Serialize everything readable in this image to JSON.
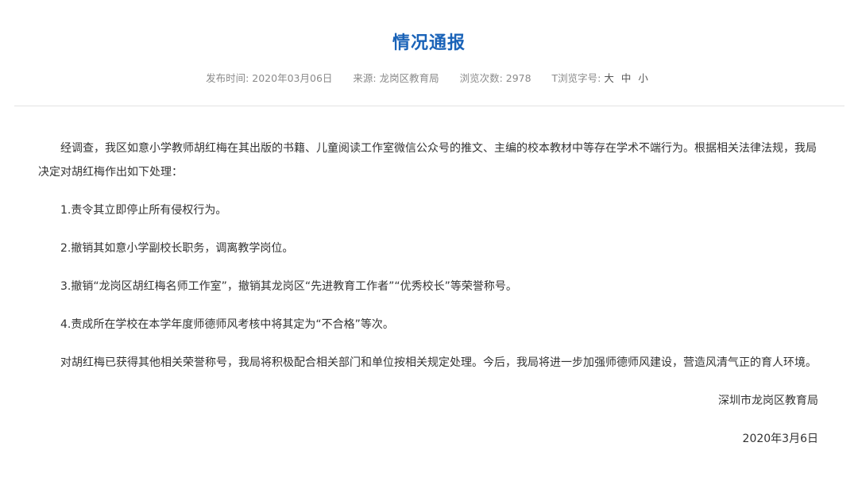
{
  "article": {
    "title": "情况通报",
    "meta": {
      "publish_label": "发布时间:",
      "publish_value": "2020年03月06日",
      "source_label": "来源:",
      "source_value": "龙岗区教育局",
      "views_label": "浏览次数:",
      "views_value": "2978",
      "fontsize_label": "T浏览字号:",
      "fontsize_large": "大",
      "fontsize_medium": "中",
      "fontsize_small": "小"
    },
    "paragraphs": [
      "经调查，我区如意小学教师胡红梅在其出版的书籍、儿童阅读工作室微信公众号的推文、主编的校本教材中等存在学术不端行为。根据相关法律法规，我局决定对胡红梅作出如下处理：",
      "1.责令其立即停止所有侵权行为。",
      "2.撤销其如意小学副校长职务，调离教学岗位。",
      "3.撤销“龙岗区胡红梅名师工作室”，撤销其龙岗区“先进教育工作者”“优秀校长”等荣誉称号。",
      "4.责成所在学校在本学年度师德师风考核中将其定为“不合格”等次。",
      "对胡红梅已获得其他相关荣誉称号，我局将积极配合相关部门和单位按相关规定处理。今后，我局将进一步加强师德师风建设，营造风清气正的育人环境。"
    ],
    "signature": "深圳市龙岗区教育局",
    "date": "2020年3月6日"
  }
}
